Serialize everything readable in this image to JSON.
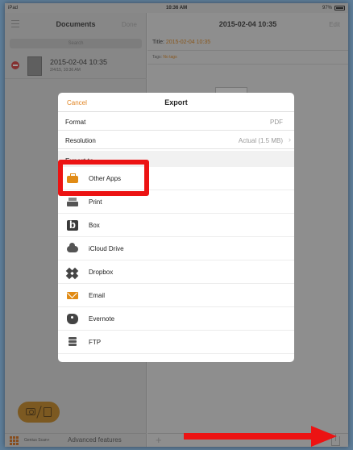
{
  "statusbar": {
    "device": "iPad",
    "time": "10:36 AM",
    "battery": "97%"
  },
  "left_panel": {
    "title": "Documents",
    "done_label": "Done",
    "search_placeholder": "Search",
    "document": {
      "title": "2015-02-04 10:35",
      "date": "2/4/15, 10:36 AM"
    },
    "genius_label": "Genius Scan+",
    "advanced_label": "Advanced features"
  },
  "right_panel": {
    "title": "2015-02-04 10:35",
    "edit_label": "Edit",
    "meta_title_label": "Title:",
    "meta_title_value": "2015-02-04 10:35",
    "tags_label": "Tags:",
    "tags_value": "No tags"
  },
  "export_dialog": {
    "cancel_label": "Cancel",
    "title": "Export",
    "format_label": "Format",
    "format_value": "PDF",
    "resolution_label": "Resolution",
    "resolution_value": "Actual (1.5 MB)",
    "section_label": "Export to",
    "targets": [
      {
        "label": "Other Apps",
        "icon": "briefcase-icon"
      },
      {
        "label": "Print",
        "icon": "printer-icon"
      },
      {
        "label": "Box",
        "icon": "box-icon"
      },
      {
        "label": "iCloud Drive",
        "icon": "cloud-icon"
      },
      {
        "label": "Dropbox",
        "icon": "dropbox-icon"
      },
      {
        "label": "Email",
        "icon": "email-icon"
      },
      {
        "label": "Evernote",
        "icon": "evernote-icon"
      },
      {
        "label": "FTP",
        "icon": "ftp-icon"
      }
    ]
  },
  "colors": {
    "accent": "#e0821f",
    "highlight": "#ec1313"
  }
}
